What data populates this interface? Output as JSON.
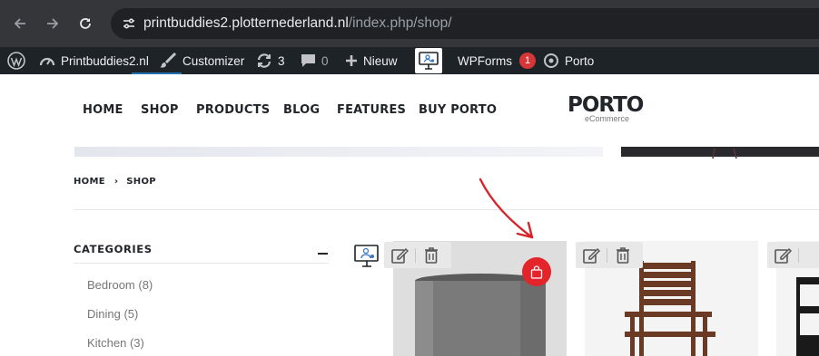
{
  "browser": {
    "url_host": "printbuddies2.plotternederland.nl",
    "url_path": "/index.php/shop/",
    "icons": [
      "back-arrow-icon",
      "forward-arrow-icon",
      "reload-icon",
      "site-settings-icon"
    ]
  },
  "adminbar": {
    "site_name": "Printbuddies2.nl",
    "customizer": "Customizer",
    "updates_count": "3",
    "comments_count": "0",
    "new_label": "Nieuw",
    "wpforms_label": "WPForms",
    "wpforms_badge": "1",
    "porto_label": "Porto"
  },
  "header": {
    "menu": [
      {
        "label": "HOME"
      },
      {
        "label": "SHOP"
      },
      {
        "label": "PRODUCTS"
      },
      {
        "label": "BLOG"
      },
      {
        "label": "FEATURES"
      },
      {
        "label": "BUY PORTO"
      }
    ],
    "logo_main": "PORTO",
    "logo_sub": "eCommerce"
  },
  "breadcrumb": {
    "home": "HOME",
    "current": "SHOP"
  },
  "sidebar": {
    "title": "CATEGORIES",
    "items": [
      {
        "label": "Bedroom (8)"
      },
      {
        "label": "Dining (5)"
      },
      {
        "label": "Kitchen (3)"
      }
    ]
  },
  "colors": {
    "chrome_bg": "#35363a",
    "adminbar_bg": "#1d2327",
    "accent_red": "#e3242b",
    "badge_red": "#d63638"
  }
}
